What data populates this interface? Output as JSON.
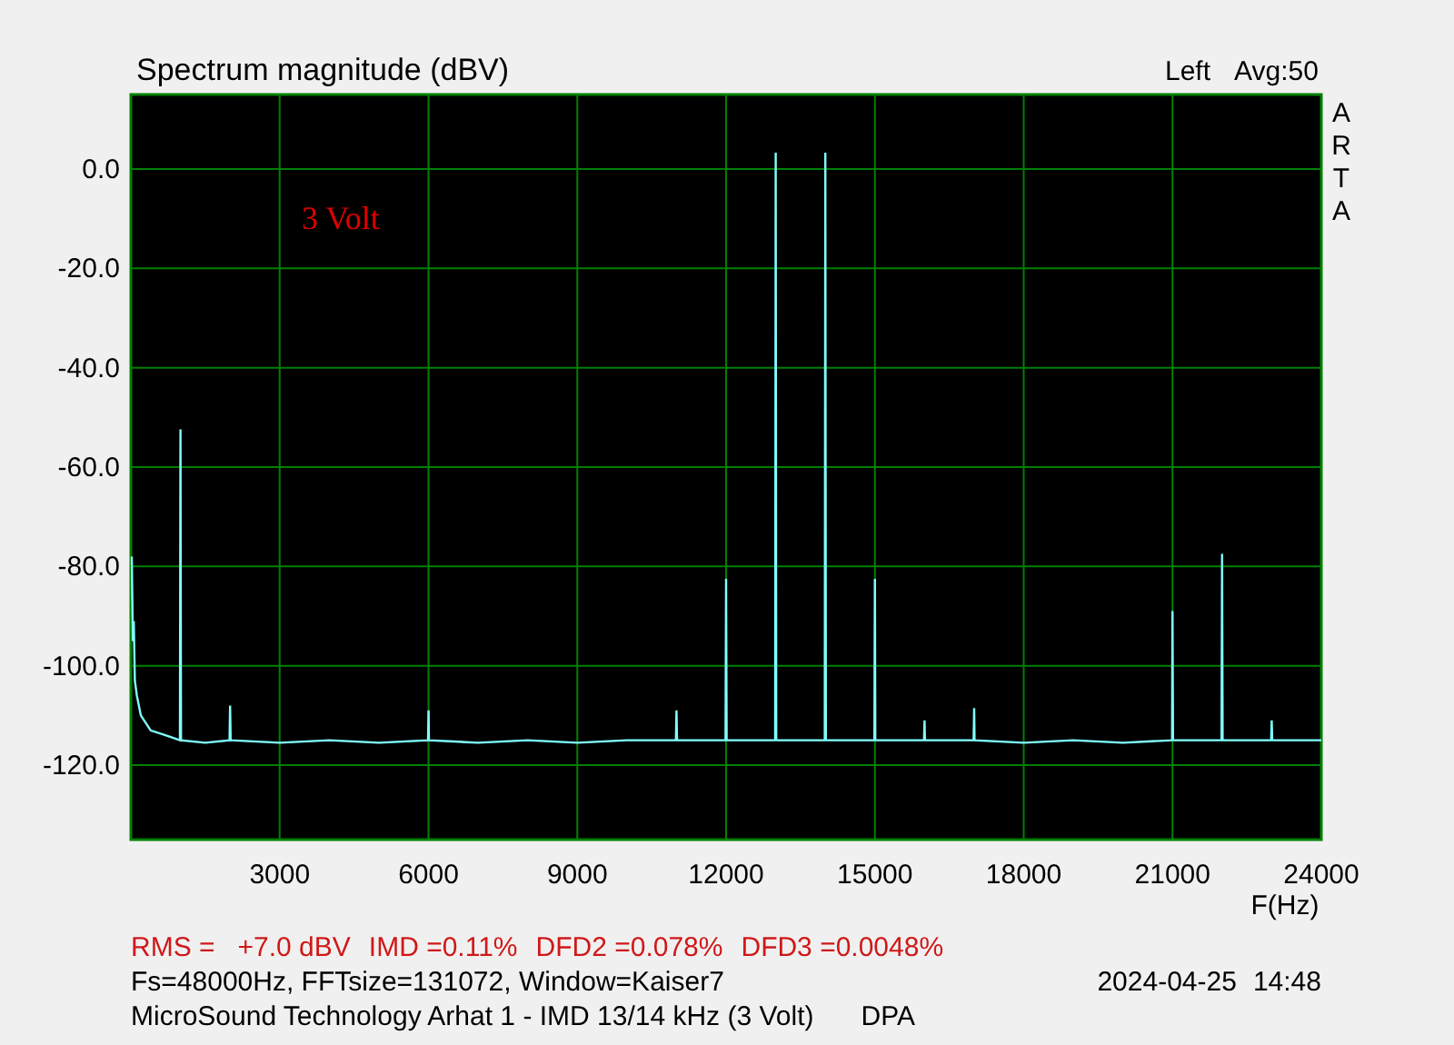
{
  "chart": {
    "average": "Avg:50",
    "logo": "ARTA",
    "chart_data": {
      "type": "line",
      "title": "Spectrum magnitude (dBV)",
      "xlabel": "F(Hz)",
      "xlim": [
        0,
        24000
      ],
      "ylim": [
        -135,
        15
      ],
      "xticks": [
        3000,
        6000,
        9000,
        12000,
        15000,
        18000,
        21000,
        24000
      ],
      "yticks": [
        {
          "value": 0,
          "label": "0.0"
        },
        {
          "value": -20,
          "label": "-20.0"
        },
        {
          "value": -40,
          "label": "-40.0"
        },
        {
          "value": -60,
          "label": "-60.0"
        },
        {
          "value": -80,
          "label": "-80.0"
        },
        {
          "value": -100,
          "label": "-100.0"
        },
        {
          "value": -120,
          "label": "-120.0"
        }
      ],
      "x": [
        20,
        40,
        60,
        80,
        120,
        200,
        400,
        700,
        990,
        1000,
        1010,
        1500,
        1990,
        2000,
        2010,
        3000,
        4000,
        5000,
        5990,
        6000,
        6010,
        7000,
        8000,
        9000,
        10000,
        10990,
        11000,
        11010,
        11990,
        12000,
        12010,
        12990,
        13000,
        13010,
        13990,
        14000,
        14010,
        14990,
        15000,
        15010,
        15990,
        16000,
        16010,
        16990,
        17000,
        17010,
        18000,
        19000,
        20000,
        20990,
        21000,
        21010,
        21990,
        22000,
        22010,
        22990,
        23000,
        23010,
        24000
      ],
      "series": [
        {
          "name": "Left",
          "color": "#80ffff",
          "values": [
            -78,
            -95,
            -91,
            -103,
            -106,
            -110,
            -113,
            -114,
            -115,
            -52.4,
            -115,
            -115.5,
            -115,
            -108,
            -115,
            -115.5,
            -115,
            -115.5,
            -115,
            -109,
            -115,
            -115.5,
            -115,
            -115.5,
            -115,
            -115,
            -109,
            -115,
            -115,
            -82.5,
            -115,
            -115,
            3.3,
            -115,
            -115,
            3.3,
            -115,
            -115,
            -82.5,
            -115,
            -115,
            -111,
            -115,
            -115,
            -108.5,
            -115,
            -115.5,
            -115,
            -115.5,
            -115,
            -89,
            -115,
            -115,
            -77.5,
            -115,
            -115,
            -111,
            -115,
            -115
          ]
        }
      ],
      "grid": true,
      "annotations": [
        "3 Volt"
      ]
    }
  },
  "measurements": [
    "RMS =   +7.0 dBV",
    "IMD =0.11%",
    "DFD2 =0.078%",
    "DFD3 =0.0048%"
  ],
  "settings": "Fs=48000Hz, FFTsize=131072, Window=Kaiser7",
  "date": "2024-04-25",
  "time": "14:48",
  "caption": "MicroSound Technology Arhat 1 - IMD 13/14 kHz (3 Volt)",
  "tag": "DPA"
}
